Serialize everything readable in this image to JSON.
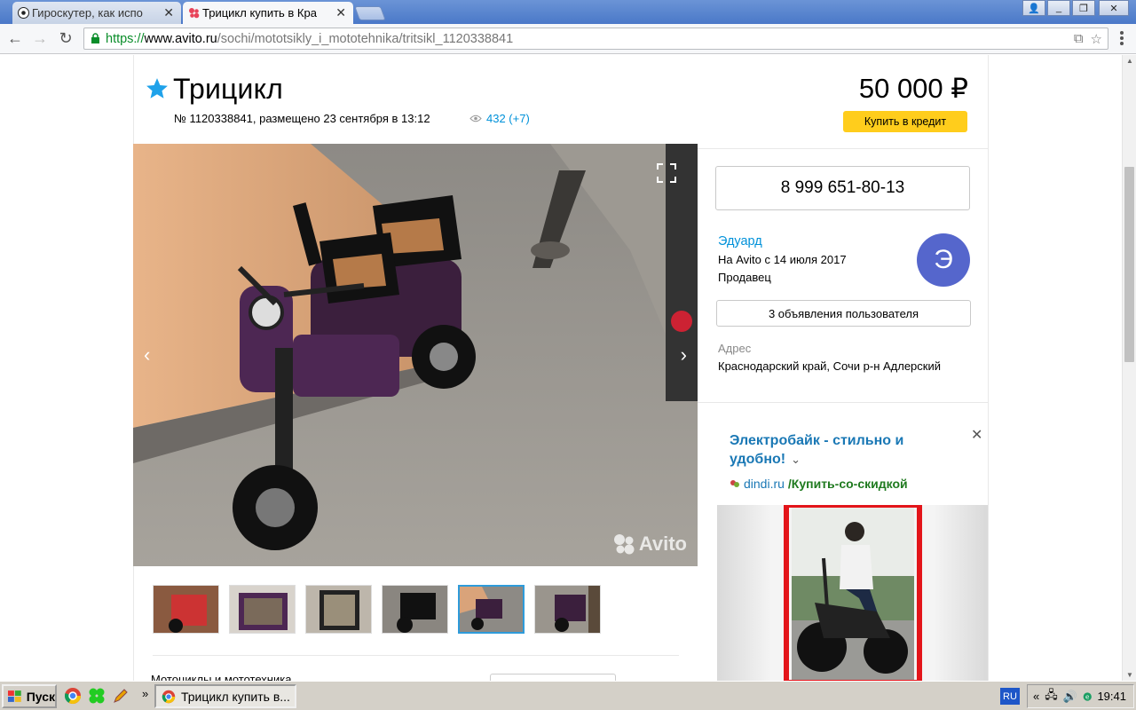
{
  "browser": {
    "tabs": [
      {
        "title": "Гироскутер, как испо",
        "active": false
      },
      {
        "title": "Трицикл купить в Кра",
        "active": true
      }
    ],
    "url_scheme": "https://",
    "url_host": "www.avito.ru",
    "url_path": "/sochi/mototsikly_i_mototehnika/tritsikl_1120338841"
  },
  "listing": {
    "title": "Трицикл",
    "meta": "№ 1120338841, размещено 23 сентября в 13:12",
    "views": "432 (+7)",
    "price": "50 000 ₽",
    "credit_label": "Купить в кредит",
    "watermark": "Avito",
    "thumbnails_count": 6,
    "selected_thumbnail": 4,
    "partial_text": "Мотоциклы и мототехника"
  },
  "seller": {
    "phone": "8 999 651-80-13",
    "name": "Эдуард",
    "since": "На Avito с 14 июля 2017",
    "role": "Продавец",
    "avatar_letter": "Э",
    "listings_label": "3 объявления пользователя",
    "address_label": "Адрес",
    "address": "Краснодарский край, Сочи р-н Адлерский"
  },
  "ad": {
    "title": "Электробайк - стильно и удобно!",
    "domain": "dindi.ru",
    "path": "/Купить-со-скидкой"
  },
  "taskbar": {
    "start_label": "Пуск",
    "task_label": "Трицикл купить в...",
    "lang": "RU",
    "tray_prefix": "«",
    "clock": "19:41"
  },
  "colors": {
    "accent_blue": "#0091d9",
    "credit_yellow": "#ffcd1c",
    "avatar": "#5566cc",
    "ad_title": "#1a78b5"
  }
}
